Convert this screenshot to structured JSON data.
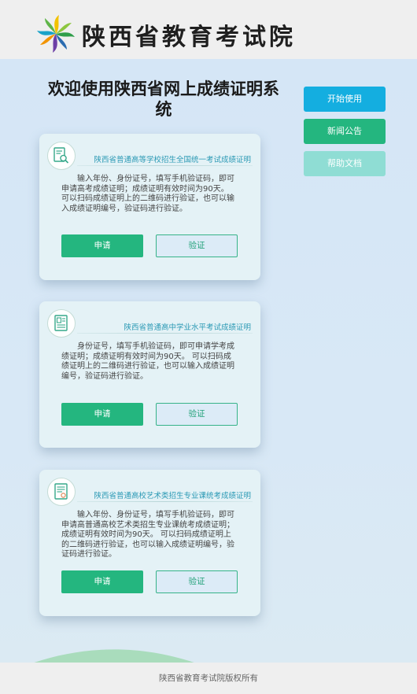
{
  "header": {
    "title": "陕西省教育考试院",
    "logo_icon": "pinwheel-logo",
    "logo_colors": [
      "#f2c200",
      "#2f9e4a",
      "#6c3fa6",
      "#1aa3c9"
    ]
  },
  "page_title": "欢迎使用陕西省网上成绩证明系统",
  "side_nav": {
    "start_label": "开始使用",
    "news_label": "新闻公告",
    "help_label": "帮助文档"
  },
  "cards": [
    {
      "icon": "search-document-icon",
      "title": "陕西省普通高等学校招生全国统一考试成绩证明",
      "description": "输入年份、身份证号，填写手机验证码，即可申请高考成绩证明；成绩证明有效时间为90天。 可以扫码成绩证明上的二维码进行验证，也可以输入成绩证明编号，验证码进行验证。",
      "apply_label": "申请",
      "verify_label": "验证"
    },
    {
      "icon": "id-document-icon",
      "title": "陕西省普通高中学业水平考试成绩证明",
      "description": "身份证号，填写手机验证码，即可申请学考成绩证明；成绩证明有效时间为90天。 可以扫码成绩证明上的二维码进行验证，也可以输入成绩证明编号，验证码进行验证。",
      "apply_label": "申请",
      "verify_label": "验证"
    },
    {
      "icon": "certificate-document-icon",
      "title": "陕西省普通高校艺术类招生专业课统考成绩证明",
      "description": "输入年份、身份证号，填写手机验证码，即可申请高普通高校艺术类招生专业课统考成绩证明；成绩证明有效时间为90天。 可以扫码成绩证明上的二维码进行验证，也可以输入成绩证明编号，验证码进行验证。",
      "apply_label": "申请",
      "verify_label": "验证"
    }
  ],
  "footer": {
    "copyright": "陕西省教育考试院版权所有"
  },
  "colors": {
    "primary_green": "#24b67f",
    "accent_blue": "#14aee0",
    "light_teal": "#8fddd4",
    "card_title": "#2c9ab5"
  }
}
